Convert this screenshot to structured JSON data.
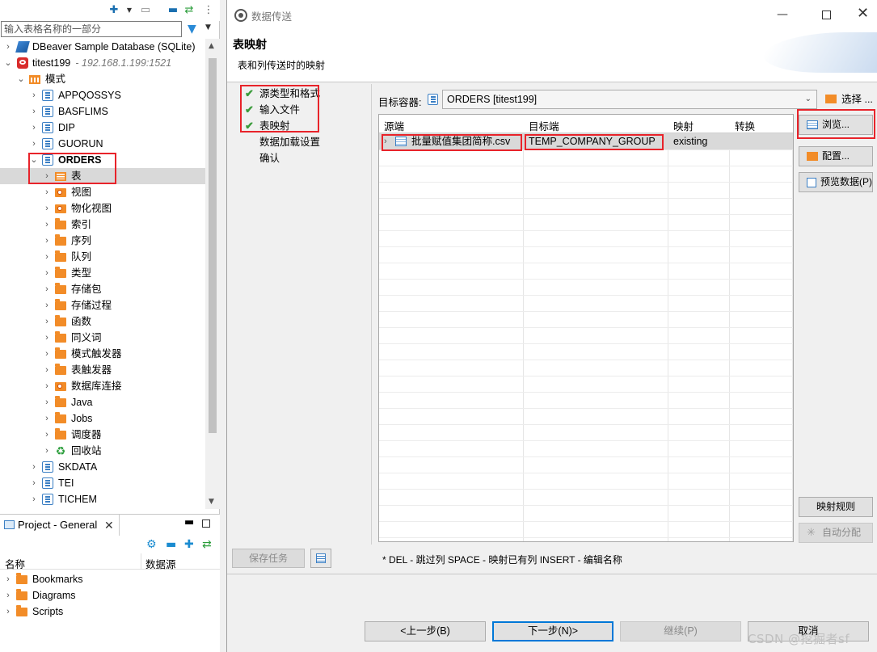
{
  "left": {
    "filter_placeholder": "输入表格名称的一部分",
    "tree": [
      {
        "label": "DBeaver Sample Database (SQLite)",
        "sub": ""
      },
      {
        "label": "titest199",
        "sub": "- 192.168.1.199:1521"
      },
      {
        "label": "模式"
      },
      {
        "label": "APPQOSSYS"
      },
      {
        "label": "BASFLIMS"
      },
      {
        "label": "DIP"
      },
      {
        "label": "GUORUN"
      },
      {
        "label": "ORDERS"
      },
      {
        "label": "表"
      },
      {
        "label": "视图"
      },
      {
        "label": "物化视图"
      },
      {
        "label": "索引"
      },
      {
        "label": "序列"
      },
      {
        "label": "队列"
      },
      {
        "label": "类型"
      },
      {
        "label": "存储包"
      },
      {
        "label": "存储过程"
      },
      {
        "label": "函数"
      },
      {
        "label": "同义词"
      },
      {
        "label": "模式触发器"
      },
      {
        "label": "表触发器"
      },
      {
        "label": "数据库连接"
      },
      {
        "label": "Java"
      },
      {
        "label": "Jobs"
      },
      {
        "label": "调度器"
      },
      {
        "label": "回收站"
      },
      {
        "label": "SKDATA"
      },
      {
        "label": "TEI"
      },
      {
        "label": "TICHEM"
      }
    ],
    "project": {
      "tab_label": "Project - General",
      "col_name": "名称",
      "col_source": "数据源",
      "items": [
        "Bookmarks",
        "Diagrams",
        "Scripts"
      ]
    }
  },
  "dialog": {
    "window_title": "数据传送",
    "page_title": "表映射",
    "page_desc": "表和列传送时的映射",
    "steps": [
      {
        "label": "源类型和格式",
        "done": true
      },
      {
        "label": "输入文件",
        "done": true
      },
      {
        "label": "表映射",
        "done": true
      },
      {
        "label": "数据加载设置",
        "done": false
      },
      {
        "label": "确认",
        "done": false
      }
    ],
    "save_task_label": "保存任务",
    "target_label": "目标容器:",
    "target_value": "ORDERS  [titest199]",
    "select_label": "选择 ...",
    "grid": {
      "headers": [
        "源端",
        "目标端",
        "映射",
        "转换"
      ],
      "rows": [
        {
          "source": "批量赋值集团简称.csv",
          "target": "TEMP_COMPANY_GROUP",
          "mapping": "existing",
          "transform": ""
        }
      ]
    },
    "side_buttons": {
      "browse": "浏览...",
      "configure": "配置...",
      "preview": "预览数据(P)",
      "rules": "映射规则",
      "auto_assign": "自动分配"
    },
    "hint": "* DEL - 跳过列  SPACE - 映射已有列  INSERT - 编辑名称",
    "nav": {
      "back": "<上一步(B)",
      "next": "下一步(N)>",
      "proceed": "继续(P)",
      "cancel": "取消"
    }
  },
  "watermark": "CSDN @挖掘者sf",
  "colors": {
    "highlight_red": "#e8232a",
    "accent_blue": "#0078d7",
    "check_green": "#3a9b3a",
    "folder_orange": "#f28c28"
  }
}
